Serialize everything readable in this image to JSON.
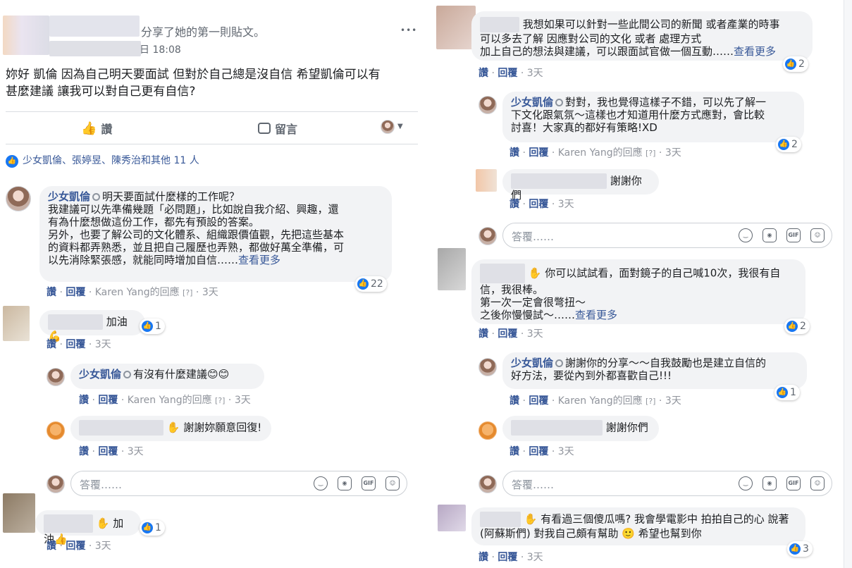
{
  "post": {
    "shared_text": "分享了她的第一則貼文。",
    "time_suffix": "日 18:08",
    "more_glyph": "•••",
    "body_line1": "妳好 凱倫 因為自己明天要面試 但對於自己總是沒自信 希望凱倫可以有",
    "body_line2": "甚麼建議 讓我可以對自己更有自信?",
    "like_label": "讚",
    "comment_label": "留言",
    "reactions_summary": "少女凱倫、張婷昱、陳秀治和其他 11 人"
  },
  "labels": {
    "like": "讚",
    "reply": "回覆",
    "reply_placeholder": "答覆……",
    "time_3d": "3天",
    "karen_reply": "Karen Yang的回應",
    "edited": "[?]",
    "sep": "·",
    "see_more": "查看更多"
  },
  "left_comments": {
    "c1_name": "少女凱倫",
    "c1_l1": "明天要面試什麼樣的工作呢？",
    "c1_l2": "我建議可以先準備幾題「必問題」，比如說自我介紹、興趣，還",
    "c1_l3": "有為什麼想做這份工作，都先有預設的答案。",
    "c1_l4": "另外，也要了解公司的文化體系、組織跟價值觀，先把這些基本",
    "c1_l5": "的資料都弄熟悉，並且把自己履歷也弄熟，都做好萬全準備，可",
    "c1_l6": "以先消除緊張感，就能同時增加自信……",
    "c1_likes": "22",
    "c2_text": "加油💪",
    "c2_likes": "1",
    "c3_name": "少女凱倫",
    "c3_text": "有沒有什麼建議😊😊",
    "c4_text": "謝謝妳願意回復!",
    "c5_text": "加油👍",
    "c5_likes": "1"
  },
  "right_comments": {
    "r1_l1": "我想如果可以針對一些此間公司的新聞 或者產業的時事",
    "r1_l2": "可以多去了解 因應對公司的文化 或者 處理方式",
    "r1_l3": "加上自己的想法與建議，可以跟面試官做一個互動……",
    "r1_likes": "2",
    "r2_name": "少女凱倫",
    "r2_l1": "對對，我也覺得這樣子不錯，可以先了解一",
    "r2_l2": "下文化跟氣氛～這樣也才知道用什麼方式應對，會比較",
    "r2_l3": "討喜！大家真的都好有策略!XD",
    "r2_likes": "2",
    "r3_text": "謝謝你們",
    "r4_l1": "你可以試試看，面對鏡子的自己喊10次，我很有自",
    "r4_l2": "信，我很棒。",
    "r4_l3": "第一次一定會很彆扭～",
    "r4_l4": "之後你慢慢試～……",
    "r4_likes": "2",
    "r5_name": "少女凱倫",
    "r5_l1": "謝謝你的分享～～自我鼓勵也是建立自信的",
    "r5_l2": "好方法，要從內到外都喜歡自己!!!",
    "r5_likes": "1",
    "r6_text": "謝謝你們",
    "r7_l1": "有看過三個傻瓜嗎? 我會學電影中 拍拍自己的心 說著",
    "r7_l2": "(阿蘇斯們) 對我自己頗有幫助 🙂 希望也幫到你",
    "r7_likes": "3"
  },
  "colors": {
    "link": "#385898",
    "like_blue": "#1877f2",
    "meta_grey": "#90949c",
    "bubble": "#f2f3f5"
  }
}
